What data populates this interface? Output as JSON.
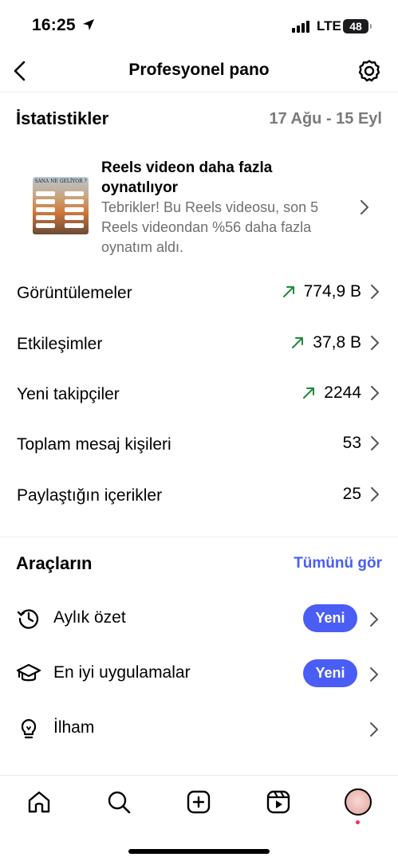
{
  "status_bar": {
    "time": "16:25",
    "network": "LTE",
    "battery": "48"
  },
  "header": {
    "title": "Profesyonel pano"
  },
  "stats": {
    "title": "İstatistikler",
    "date_range": "17 Ağu - 15 Eyl",
    "reels_card": {
      "thumbnail_caption": "SANA NE GELİYOR ?",
      "title": "Reels videon daha fazla oynatılıyor",
      "description": "Tebrikler! Bu Reels videosu, son 5 Reels videondan %56 daha fazla oynatım aldı."
    },
    "rows": [
      {
        "label": "Görüntülemeler",
        "value": "774,9 B",
        "trend": "up"
      },
      {
        "label": "Etkileşimler",
        "value": "37,8 B",
        "trend": "up"
      },
      {
        "label": "Yeni takipçiler",
        "value": "2244",
        "trend": "up"
      },
      {
        "label": "Toplam mesaj kişileri",
        "value": "53",
        "trend": "none"
      },
      {
        "label": "Paylaştığın içerikler",
        "value": "25",
        "trend": "none"
      }
    ]
  },
  "tools": {
    "title": "Araçların",
    "see_all": "Tümünü gör",
    "items": [
      {
        "label": "Aylık özet",
        "badge": "Yeni",
        "icon": "history-icon"
      },
      {
        "label": "En iyi uygulamalar",
        "badge": "Yeni",
        "icon": "graduation-cap-icon"
      },
      {
        "label": "İlham",
        "badge": "",
        "icon": "lightbulb-icon"
      }
    ]
  },
  "bottom_nav": [
    "home-icon",
    "search-icon",
    "create-icon",
    "reels-icon",
    "profile-avatar"
  ],
  "colors": {
    "accent": "#4a5df5",
    "trend_up": "#1f8a3a",
    "secondary_text": "#6f6f6f"
  }
}
